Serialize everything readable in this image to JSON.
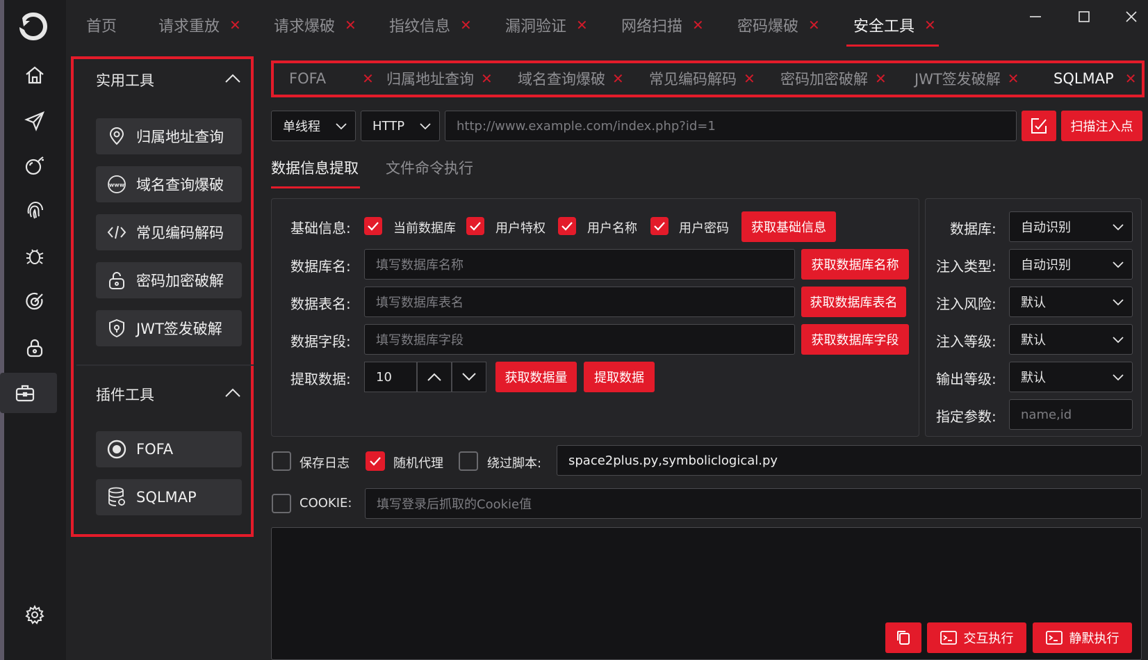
{
  "app": {
    "logo": "dragon-logo-icon"
  },
  "rail": {
    "items": [
      {
        "icon": "home-icon"
      },
      {
        "icon": "send-icon"
      },
      {
        "icon": "bomb-icon"
      },
      {
        "icon": "fingerprint-icon"
      },
      {
        "icon": "bug-icon"
      },
      {
        "icon": "scan-icon"
      },
      {
        "icon": "lock-icon"
      },
      {
        "icon": "toolbox-icon"
      }
    ],
    "settings": "gear-icon"
  },
  "top_tabs": [
    {
      "label": "首页",
      "closable": false
    },
    {
      "label": "请求重放",
      "closable": true
    },
    {
      "label": "请求爆破",
      "closable": true
    },
    {
      "label": "指纹信息",
      "closable": true
    },
    {
      "label": "漏洞验证",
      "closable": true
    },
    {
      "label": "网络扫描",
      "closable": true
    },
    {
      "label": "密码爆破",
      "closable": true
    },
    {
      "label": "安全工具",
      "closable": true,
      "active": true
    }
  ],
  "close_glyph": "✕",
  "panel": {
    "utility_title": "实用工具",
    "utility_items": [
      {
        "label": "归属地址查询",
        "icon": "location-pin-icon"
      },
      {
        "label": "域名查询爆破",
        "icon": "www-icon"
      },
      {
        "label": "常见编码解码",
        "icon": "code-icon"
      },
      {
        "label": "密码加密破解",
        "icon": "lock-icon"
      },
      {
        "label": "JWT签发破解",
        "icon": "shield-icon"
      }
    ],
    "plugin_title": "插件工具",
    "plugin_items": [
      {
        "label": "FOFA",
        "icon": "target-icon"
      },
      {
        "label": "SQLMAP",
        "icon": "database-icon"
      }
    ]
  },
  "sub_tabs": [
    {
      "label": "FOFA"
    },
    {
      "label": "归属地址查询"
    },
    {
      "label": "域名查询爆破"
    },
    {
      "label": "常见编码解码"
    },
    {
      "label": "密码加密破解"
    },
    {
      "label": "JWT签发破解"
    },
    {
      "label": "SQLMAP",
      "active": true
    }
  ],
  "controls": {
    "thread_mode": "单线程",
    "protocol": "HTTP",
    "url_placeholder": "http://www.example.com/index.php?id=1",
    "scan_button": "扫描注入点"
  },
  "inner_tabs": {
    "data_extract": "数据信息提取",
    "file_exec": "文件命令执行"
  },
  "extract": {
    "basic_label": "基础信息:",
    "checks": [
      {
        "label": "当前数据库",
        "checked": true
      },
      {
        "label": "用户特权",
        "checked": true
      },
      {
        "label": "用户名称",
        "checked": true
      },
      {
        "label": "用户密码",
        "checked": true
      }
    ],
    "get_basic": "获取基础信息",
    "db_name_label": "数据库名:",
    "db_name_placeholder": "填写数据库名称",
    "get_db_name": "获取数据库名称",
    "table_label": "数据表名:",
    "table_placeholder": "填写数据库表名",
    "get_table": "获取数据库表名",
    "field_label": "数据字段:",
    "field_placeholder": "填写数据库字段",
    "get_field": "获取数据库字段",
    "extract_label": "提取数据:",
    "extract_count": "10",
    "get_count": "获取数据量",
    "extract_btn": "提取数据"
  },
  "options": {
    "database_label": "数据库:",
    "database_value": "自动识别",
    "inject_type_label": "注入类型:",
    "inject_type_value": "自动识别",
    "risk_label": "注入风险:",
    "risk_value": "默认",
    "level_label": "注入等级:",
    "level_value": "默认",
    "output_label": "输出等级:",
    "output_value": "默认",
    "param_label": "指定参数:",
    "param_placeholder": "name,id"
  },
  "bottom": {
    "save_log": "保存日志",
    "save_log_checked": false,
    "random_proxy": "随机代理",
    "random_proxy_checked": true,
    "tamper_label": "绕过脚本:",
    "tamper_value": "space2plus.py,symboliclogical.py",
    "cookie_label": "COOKIE:",
    "cookie_checked": false,
    "cookie_placeholder": "填写登录后抓取的Cookie值",
    "interactive_exec": "交互执行",
    "silent_exec": "静默执行"
  },
  "colors": {
    "accent": "#e31b2a",
    "background": "#232325",
    "input_bg": "#141416"
  }
}
